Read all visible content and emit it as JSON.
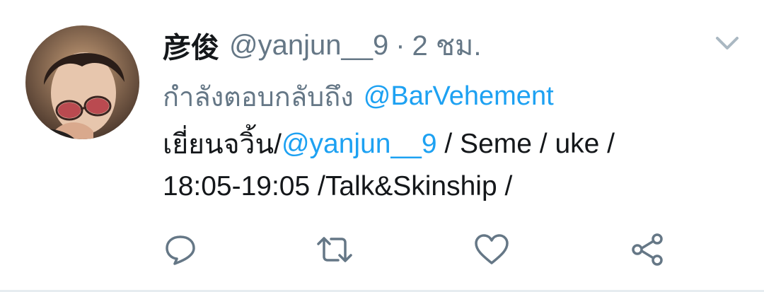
{
  "tweet": {
    "display_name": "彦俊",
    "handle": "@yanjun__9",
    "separator": "·",
    "time": "2 ชม.",
    "reply_label": "กำลังตอบกลับถึง",
    "reply_to": "@BarVehement",
    "body": {
      "line1_prefix": "เยี่ยนจวิ้น/",
      "line1_mention": "@yanjun__9",
      "line1_suffix": " / Seme / uke /",
      "line2": "18:05-19:05 /Talk&Skinship /"
    }
  },
  "actions": {
    "reply_icon": "reply-icon",
    "retweet_icon": "retweet-icon",
    "like_icon": "heart-icon",
    "share_icon": "share-icon"
  },
  "colors": {
    "text": "#14171a",
    "secondary": "#657786",
    "link": "#1da1f2",
    "icon": "#657786"
  }
}
